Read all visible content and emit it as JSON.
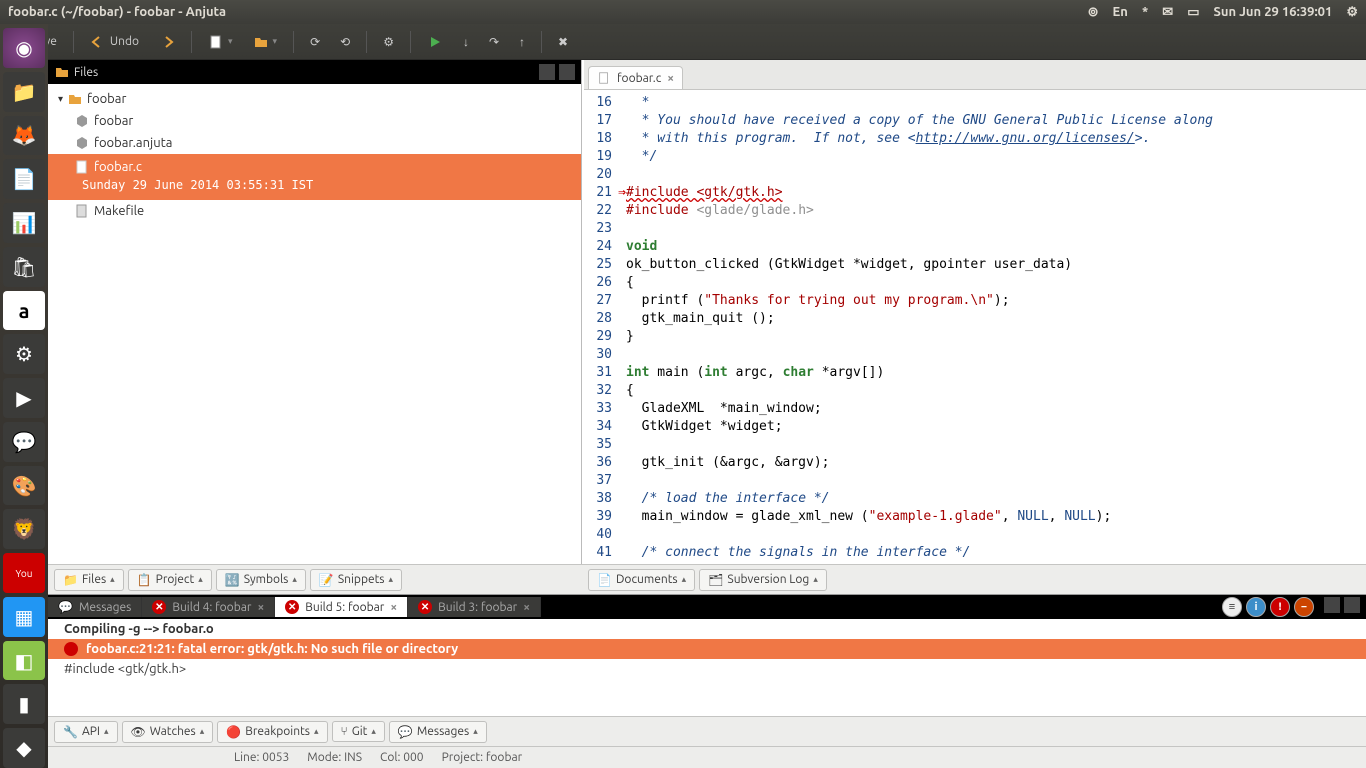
{
  "window": {
    "title": "foobar.c (~/foobar) - foobar - Anjuta"
  },
  "systray": {
    "lang": "En",
    "clock": "Sun Jun 29 16:39:01"
  },
  "toolbar": {
    "save": "Save",
    "undo": "Undo"
  },
  "files_pane": {
    "header": "Files",
    "root": "foobar",
    "items": [
      "foobar",
      "foobar.anjuta"
    ],
    "selected": {
      "name": "foobar.c",
      "date": "Sunday 29 June 2014 03:55:31  IST"
    },
    "after": [
      "Makefile"
    ]
  },
  "editor": {
    "tab": "foobar.c",
    "lines": [
      {
        "n": 16,
        "html": "  <span class='c'>*</span>"
      },
      {
        "n": 17,
        "html": "  <span class='c'>* You should have received a copy of the GNU General Public License along</span>"
      },
      {
        "n": 18,
        "html": "  <span class='c'>* with this program.  If not, see &lt;<span class='url'>http://www.gnu.org/licenses/</span>&gt;.</span>"
      },
      {
        "n": 19,
        "html": "  <span class='c'>*/</span>"
      },
      {
        "n": 20,
        "html": ""
      },
      {
        "n": 21,
        "err": true,
        "html": "<span class='pp errline'>#include &lt;gtk/gtk.h&gt;</span>"
      },
      {
        "n": 22,
        "html": "<span class='pp'>#include</span> <span class='inc'>&lt;glade/glade.h&gt;</span>"
      },
      {
        "n": 23,
        "html": ""
      },
      {
        "n": 24,
        "html": "<span class='k'>void</span>"
      },
      {
        "n": 25,
        "html": "ok_button_clicked (GtkWidget *widget, gpointer user_data)"
      },
      {
        "n": 26,
        "html": "{"
      },
      {
        "n": 27,
        "html": "  printf (<span class='s'>\"Thanks for trying out my program.\\n\"</span>);"
      },
      {
        "n": 28,
        "html": "  gtk_main_quit ();"
      },
      {
        "n": 29,
        "html": "}"
      },
      {
        "n": 30,
        "html": ""
      },
      {
        "n": 31,
        "html": "<span class='k'>int</span> main (<span class='k'>int</span> argc, <span class='k'>char</span> *argv[])"
      },
      {
        "n": 32,
        "html": "{"
      },
      {
        "n": 33,
        "html": "  GladeXML  *main_window;"
      },
      {
        "n": 34,
        "html": "  GtkWidget *widget;"
      },
      {
        "n": 35,
        "html": ""
      },
      {
        "n": 36,
        "html": "  gtk_init (&amp;argc, &amp;argv);"
      },
      {
        "n": 37,
        "html": ""
      },
      {
        "n": 38,
        "html": "  <span class='c'>/* load the interface */</span>"
      },
      {
        "n": 39,
        "html": "  main_window = glade_xml_new (<span class='s'>\"example-1.glade\"</span>, <span class='n'>NULL</span>, <span class='n'>NULL</span>);"
      },
      {
        "n": 40,
        "html": ""
      },
      {
        "n": 41,
        "html": "  <span class='c'>/* connect the signals in the interface */</span>"
      }
    ]
  },
  "dock_left": [
    "Files",
    "Project",
    "Symbols",
    "Snippets"
  ],
  "dock_right": [
    "Documents",
    "Subversion Log"
  ],
  "msg_tabs": {
    "items": [
      {
        "label": "Messages",
        "active": false,
        "closable": false,
        "err": false
      },
      {
        "label": "Build 4: foobar",
        "active": false,
        "closable": true,
        "err": true
      },
      {
        "label": "Build 5: foobar",
        "active": true,
        "closable": true,
        "err": true
      },
      {
        "label": "Build 3: foobar",
        "active": false,
        "closable": true,
        "err": true
      }
    ]
  },
  "messages": {
    "compile": "Compiling -g --> foobar.o",
    "error": "foobar.c:21:21: fatal error: gtk/gtk.h: No such file or directory",
    "include": "#include <gtk/gtk.h>"
  },
  "dock_bottom": [
    "API",
    "Watches",
    "Breakpoints",
    "Git",
    "Messages"
  ],
  "statusbar": {
    "line": "Line: 0053",
    "mode": "Mode: INS",
    "col": "Col: 000",
    "project": "Project: foobar"
  }
}
